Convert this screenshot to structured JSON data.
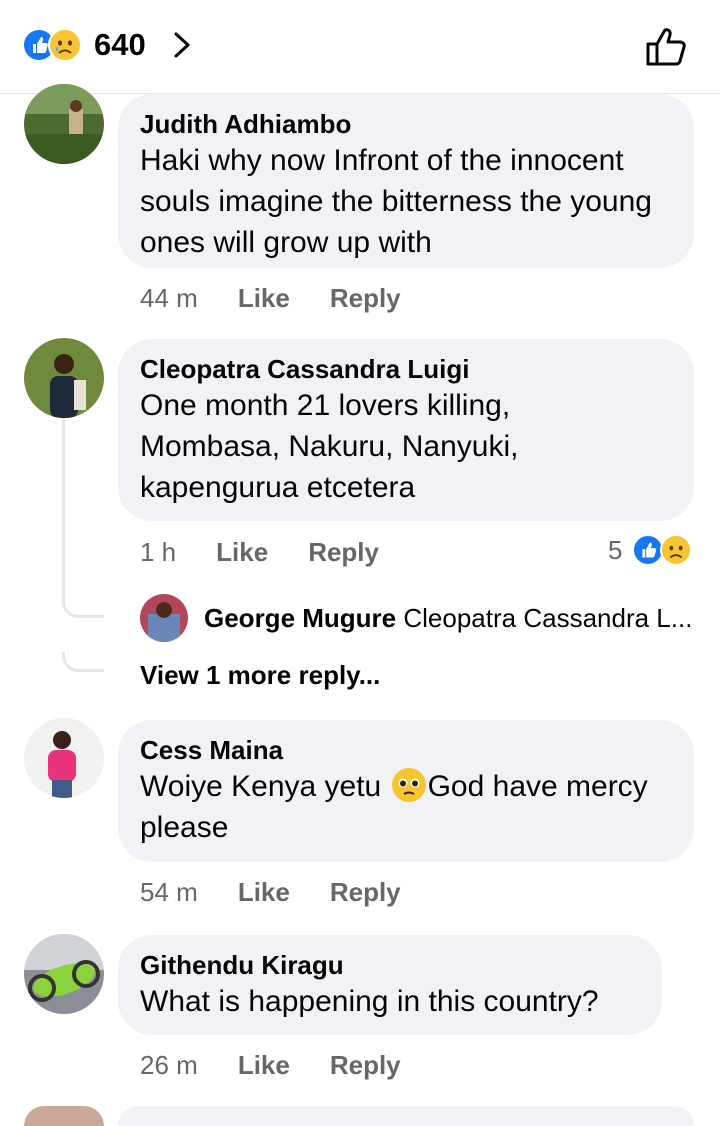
{
  "header": {
    "reaction_count": "640"
  },
  "comments": [
    {
      "author": "Judith Adhiambo",
      "text": "Haki why now Infront of the innocent souls imagine the bitterness the young ones will grow up with",
      "time": "44 m",
      "like_label": "Like",
      "reply_label": "Reply"
    },
    {
      "author": "Cleopatra Cassandra Luigi",
      "text": "One month 21 lovers killing, Mombasa, Nakuru, Nanyuki, kapengurua etcetera",
      "time": "1 h",
      "like_label": "Like",
      "reply_label": "Reply",
      "reaction_count": "5",
      "reply_preview": {
        "author": "George Mugure",
        "text": "Cleopatra Cassandra L..."
      },
      "more_replies": "View 1 more reply..."
    },
    {
      "author": "Cess Maina",
      "text_before_emoji": "Woiye Kenya yetu ",
      "text_after_emoji": "God have mercy please",
      "time": "54 m",
      "like_label": "Like",
      "reply_label": "Reply"
    },
    {
      "author": "Githendu Kiragu",
      "text": "What is happening in this country?",
      "time": "26 m",
      "like_label": "Like",
      "reply_label": "Reply"
    }
  ],
  "icons": {
    "like_reaction": "like-icon",
    "sad_reaction": "sad-face-icon",
    "chevron": "chevron-right-icon",
    "thumbs_up_button": "thumbs-up-icon"
  },
  "colors": {
    "like_blue": "#1877f2",
    "sad_yellow": "#f7c531",
    "bubble_bg": "#f0f2f5",
    "meta_gray": "#65676b"
  }
}
